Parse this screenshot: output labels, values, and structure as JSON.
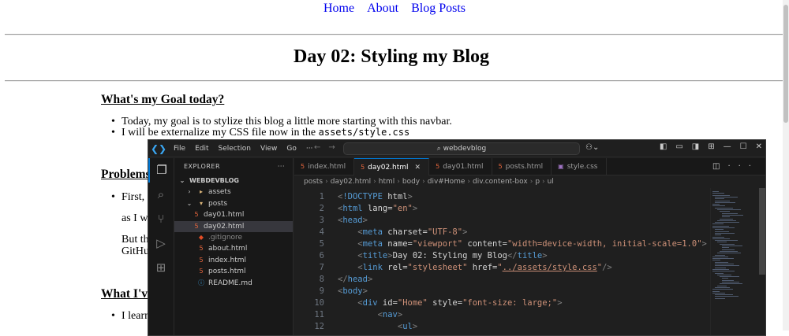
{
  "blog": {
    "nav": [
      "Home",
      "About",
      "Blog Posts"
    ],
    "title": "Day 02: Styling my Blog",
    "goal_heading": "What's my Goal today?",
    "goal_items": [
      "Today, my goal is to stylize this blog a little more starting with this navbar.",
      "I will be externalize my CSS file now in the "
    ],
    "goal_code": "assets/style.css",
    "problems_heading": "Problems",
    "problems_item": "First, P",
    "problems_p1": "as I wa",
    "problems_p2a": "But the",
    "problems_p2b": "GitHub",
    "learned_heading": "What I've",
    "learned_item": "I learne"
  },
  "vscode": {
    "menu": [
      "File",
      "Edit",
      "Selection",
      "View",
      "Go",
      "···"
    ],
    "search": "⌕ webdevblog",
    "explorer_label": "EXPLORER",
    "explorer_dots": "···",
    "workspace": "WEBDEVBLOG",
    "tree": [
      {
        "name": "assets",
        "type": "folder",
        "indent": 1,
        "chev": "›"
      },
      {
        "name": "posts",
        "type": "folder-open",
        "indent": 1,
        "chev": "⌄"
      },
      {
        "name": "day01.html",
        "type": "html",
        "indent": 2
      },
      {
        "name": "day02.html",
        "type": "html",
        "indent": 2,
        "selected": true
      },
      {
        "name": ".gitignore",
        "type": "git",
        "indent": 1
      },
      {
        "name": "about.html",
        "type": "html",
        "indent": 1
      },
      {
        "name": "index.html",
        "type": "html",
        "indent": 1
      },
      {
        "name": "posts.html",
        "type": "html",
        "indent": 1
      },
      {
        "name": "README.md",
        "type": "info",
        "indent": 1
      }
    ],
    "tabs": [
      {
        "label": "index.html",
        "type": "html"
      },
      {
        "label": "day02.html",
        "type": "html",
        "active": true
      },
      {
        "label": "day01.html",
        "type": "html"
      },
      {
        "label": "posts.html",
        "type": "html"
      },
      {
        "label": "style.css",
        "type": "css"
      }
    ],
    "breadcrumb": [
      "posts",
      "day02.html",
      "html",
      "body",
      "div#Home",
      "div.content-box",
      "p",
      "ul"
    ],
    "line_numbers": [
      "1",
      "2",
      "3",
      "4",
      "5",
      "6",
      "7",
      "8",
      "9",
      "10",
      "11",
      "12"
    ],
    "code": [
      "<!DOCTYPE html>",
      "<html lang=\"en\">",
      "<head>",
      "    <meta charset=\"UTF-8\">",
      "    <meta name=\"viewport\" content=\"width=device-width, initial-scale=1.0\">",
      "    <title>Day 02: Styling my Blog</title>",
      "    <link rel=\"stylesheet\" href=\"../assets/style.css\"/>",
      "</head>",
      "<body>",
      "    <div id=\"Home\" style=\"font-size: large;\">",
      "        <nav>",
      "            <ul>"
    ],
    "colors": {
      "accent": "#0078d4",
      "tag": "#569cd6",
      "attr": "#9cdcfe",
      "string": "#ce9178",
      "html_icon": "#e8663d"
    }
  }
}
